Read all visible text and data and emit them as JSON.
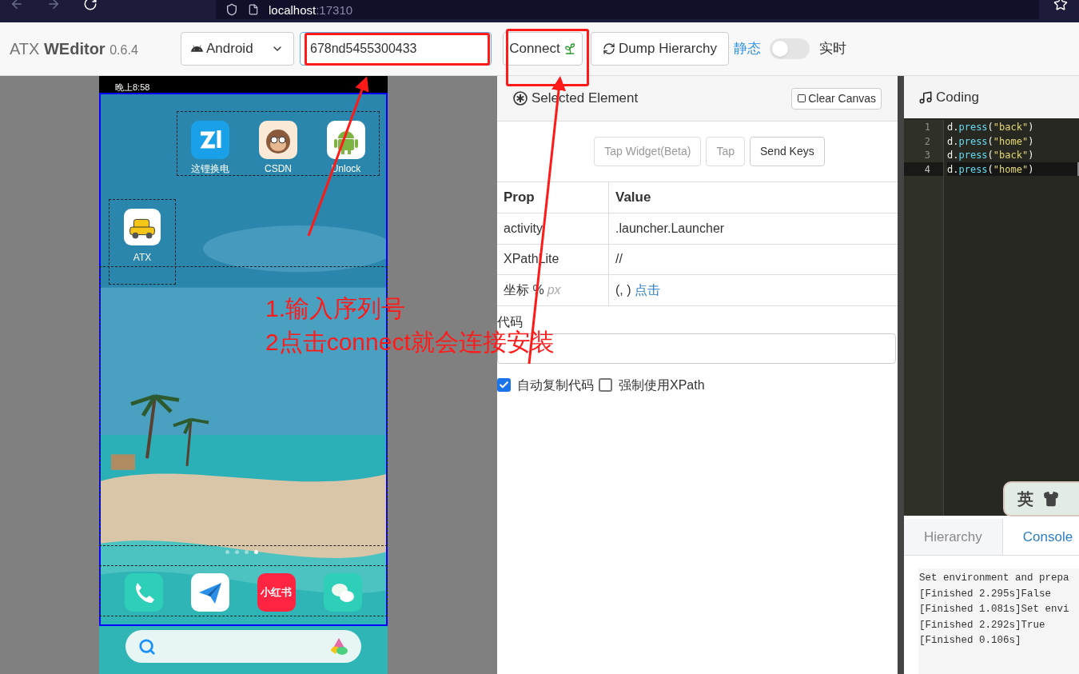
{
  "browser": {
    "host": "localhost",
    "port": ":17310"
  },
  "toolbar": {
    "brand": "ATX",
    "brand_bold": "WEditor",
    "version": "0.6.4",
    "platform": "Android",
    "serial": "678nd5455300433",
    "connect": "Connect",
    "dump": "Dump Hierarchy",
    "mode_static": "静态",
    "realtime": false,
    "mode_live": "实时"
  },
  "phone": {
    "status_time": "晚上8:58",
    "apps": [
      {
        "label": "这锂换电",
        "kind": "zl"
      },
      {
        "label": "CSDN",
        "kind": "monkey"
      },
      {
        "label": "Unlock",
        "kind": "android"
      },
      {
        "label": "ATX",
        "kind": "taxi"
      }
    ],
    "dock": [
      {
        "kind": "phone"
      },
      {
        "kind": "plane"
      },
      {
        "kind": "brand",
        "text": "小红书"
      },
      {
        "kind": "chat"
      }
    ]
  },
  "selected_element": {
    "title": "Selected Element",
    "clear": "Clear Canvas",
    "buttons": [
      {
        "label": "Tap Widget(Beta)",
        "disabled": true
      },
      {
        "label": "Tap",
        "disabled": true
      },
      {
        "label": "Send Keys",
        "disabled": false
      }
    ],
    "columns": [
      "Prop",
      "Value"
    ],
    "rows": [
      {
        "prop": "activity",
        "value": ".launcher.Launcher"
      },
      {
        "prop": "XPathLite",
        "value": "//"
      },
      {
        "prop": "坐标 %",
        "unit": "px",
        "value": "(, )",
        "link": "点击"
      }
    ],
    "code_label": "代码",
    "checkboxes": [
      {
        "label": "自动复制代码",
        "checked": true
      },
      {
        "label": "强制使用XPath",
        "checked": false
      }
    ]
  },
  "coding": {
    "title": "Coding",
    "lines": [
      {
        "number": "1",
        "selected": false,
        "tokens": [
          {
            "kind": "plain",
            "text": "d."
          },
          {
            "kind": "func",
            "text": "press"
          },
          {
            "kind": "plain",
            "text": "("
          },
          {
            "kind": "string",
            "text": "\"back\""
          },
          {
            "kind": "plain",
            "text": ")"
          }
        ]
      },
      {
        "number": "2",
        "selected": false,
        "tokens": [
          {
            "kind": "plain",
            "text": "d."
          },
          {
            "kind": "func",
            "text": "press"
          },
          {
            "kind": "plain",
            "text": "("
          },
          {
            "kind": "string",
            "text": "\"home\""
          },
          {
            "kind": "plain",
            "text": ")"
          }
        ]
      },
      {
        "number": "3",
        "selected": false,
        "tokens": [
          {
            "kind": "plain",
            "text": "d."
          },
          {
            "kind": "func",
            "text": "press"
          },
          {
            "kind": "plain",
            "text": "("
          },
          {
            "kind": "string",
            "text": "\"back\""
          },
          {
            "kind": "plain",
            "text": ")"
          }
        ]
      },
      {
        "number": "4",
        "selected": true,
        "tokens": [
          {
            "kind": "plain",
            "text": "d."
          },
          {
            "kind": "func",
            "text": "press"
          },
          {
            "kind": "plain",
            "text": "("
          },
          {
            "kind": "string",
            "text": "\"home\""
          },
          {
            "kind": "plain",
            "text": ")"
          }
        ]
      }
    ]
  },
  "bottom_tabs": [
    {
      "label": "Hierarchy",
      "selected": false
    },
    {
      "label": "Console",
      "selected": true
    }
  ],
  "console": [
    "Set environment and prepa",
    "[Finished 2.295s]False",
    "[Finished 1.081s]Set envi",
    "[Finished 2.292s]True",
    "[Finished 0.106s]"
  ],
  "ime_widget": {
    "label": "英"
  },
  "annotations": [
    "1.输入序列号",
    "2点击connect就会连接安装"
  ]
}
